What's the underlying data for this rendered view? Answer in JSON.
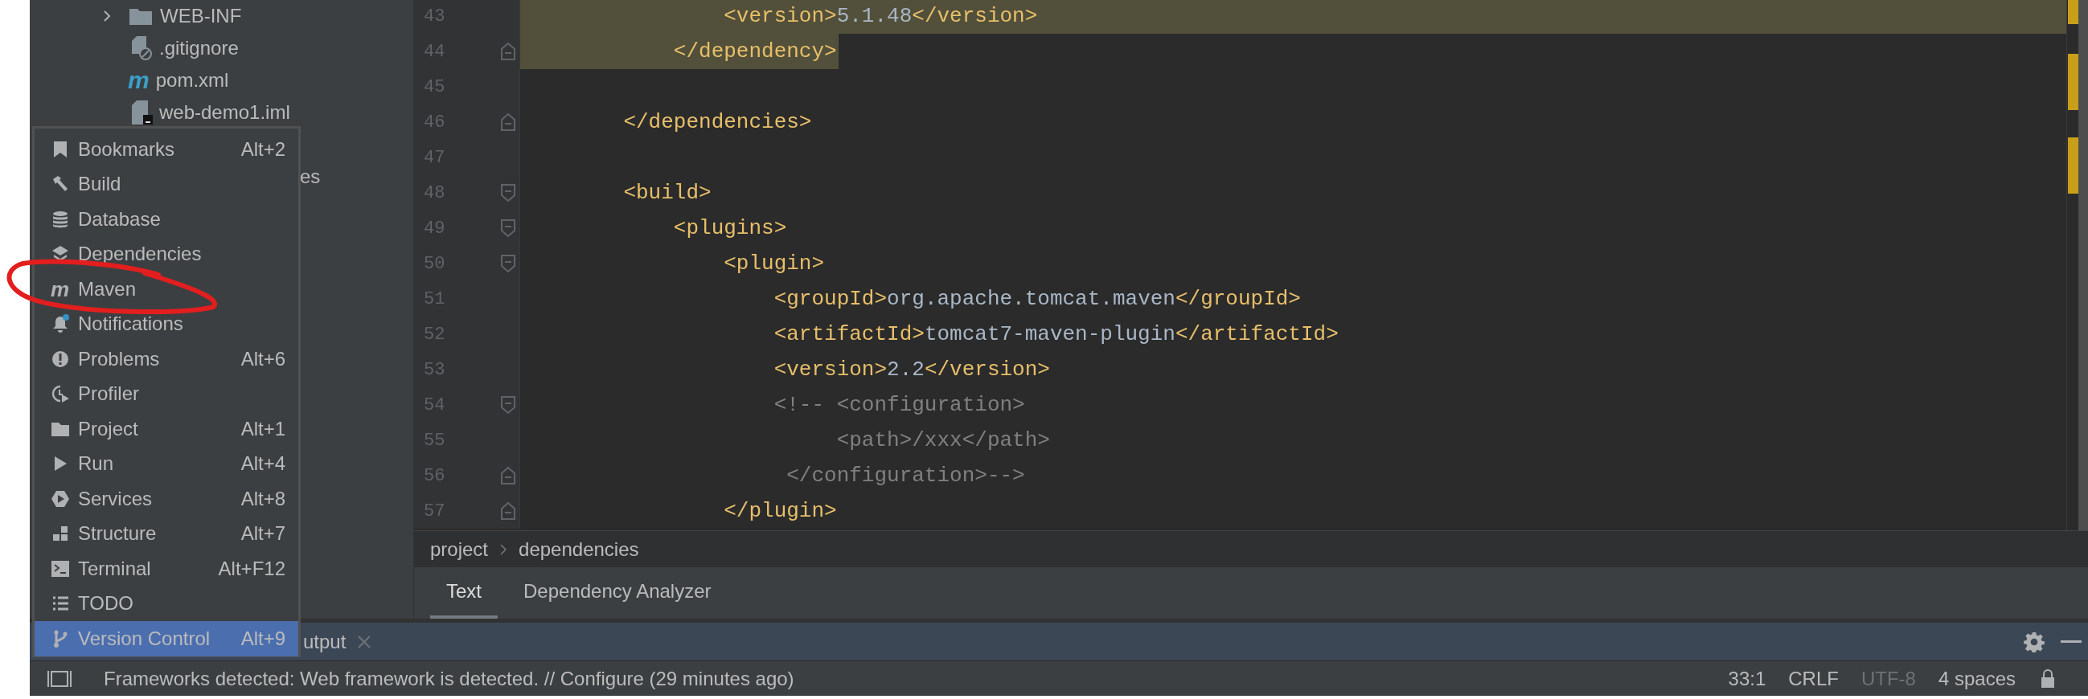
{
  "project_tree": [
    {
      "label": "WEB-INF",
      "kind": "folder",
      "expanded": false
    },
    {
      "label": ".gitignore",
      "kind": "ignore-file"
    },
    {
      "label": "pom.xml",
      "kind": "maven",
      "icon_glyph": "m"
    },
    {
      "label": "web-demo1.iml",
      "kind": "module-file"
    },
    {
      "label": "es",
      "kind": "partial"
    }
  ],
  "editor": {
    "lines": [
      {
        "number": "43",
        "kind": "plain",
        "selected": true,
        "selection_to_line_end": true,
        "segments": [
          {
            "kind": "tag",
            "text": "            <version>"
          },
          {
            "kind": "value",
            "text": "5.1.48"
          },
          {
            "kind": "tag",
            "text": "</version>"
          }
        ]
      },
      {
        "number": "44",
        "kind": "fold-end",
        "selected": true,
        "selection_to_line_end": false,
        "segments": [
          {
            "kind": "tag",
            "text": "        </dependency>"
          }
        ]
      },
      {
        "number": "45",
        "kind": "plain",
        "selected": false
      },
      {
        "number": "46",
        "kind": "fold-end",
        "selected": false,
        "segments": [
          {
            "kind": "tag",
            "text": "    </dependencies>"
          }
        ]
      },
      {
        "number": "47",
        "kind": "plain",
        "selected": false
      },
      {
        "number": "48",
        "kind": "fold-start",
        "selected": false,
        "segments": [
          {
            "kind": "tag",
            "text": "    <build>"
          }
        ]
      },
      {
        "number": "49",
        "kind": "fold-start",
        "selected": false,
        "segments": [
          {
            "kind": "tag",
            "text": "        <plugins>"
          }
        ]
      },
      {
        "number": "50",
        "kind": "fold-start",
        "selected": false,
        "segments": [
          {
            "kind": "tag",
            "text": "            <plugin>"
          }
        ]
      },
      {
        "number": "51",
        "kind": "plain",
        "selected": false,
        "segments": [
          {
            "kind": "tag",
            "text": "                <groupId>"
          },
          {
            "kind": "value",
            "text": "org.apache.tomcat.maven"
          },
          {
            "kind": "tag",
            "text": "</groupId>"
          }
        ]
      },
      {
        "number": "52",
        "kind": "plain",
        "selected": false,
        "segments": [
          {
            "kind": "tag",
            "text": "                <artifactId>"
          },
          {
            "kind": "value",
            "text": "tomcat7-maven-plugin"
          },
          {
            "kind": "tag",
            "text": "</artifactId>"
          }
        ]
      },
      {
        "number": "53",
        "kind": "plain",
        "selected": false,
        "segments": [
          {
            "kind": "tag",
            "text": "                <version>"
          },
          {
            "kind": "value",
            "text": "2.2"
          },
          {
            "kind": "tag",
            "text": "</version>"
          }
        ]
      },
      {
        "number": "54",
        "kind": "fold-start",
        "selected": false,
        "segments": [
          {
            "kind": "comment",
            "text": "                <!-- <configuration>"
          }
        ]
      },
      {
        "number": "55",
        "kind": "plain",
        "selected": false,
        "segments": [
          {
            "kind": "comment",
            "text": "                     <path>/xxx</path>"
          }
        ]
      },
      {
        "number": "56",
        "kind": "fold-end",
        "selected": false,
        "segments": [
          {
            "kind": "comment",
            "text": "                 </configuration>-->"
          }
        ]
      },
      {
        "number": "57",
        "kind": "fold-end",
        "selected": false,
        "segments": [
          {
            "kind": "tag",
            "text": "            </plugin>"
          }
        ]
      }
    ]
  },
  "breadcrumbs": [
    "project",
    "dependencies"
  ],
  "editor_tabs": [
    {
      "label": "Text",
      "selected": true
    },
    {
      "label": "Dependency Analyzer",
      "selected": false
    }
  ],
  "tool_window": {
    "tab_label": "utput"
  },
  "tool_windows_menu": [
    {
      "label": "Bookmarks",
      "shortcut": "Alt+2",
      "selected": false
    },
    {
      "label": "Build",
      "selected": false
    },
    {
      "label": "Database",
      "selected": false
    },
    {
      "label": "Dependencies",
      "selected": false
    },
    {
      "label": "Maven",
      "icon_glyph": "m",
      "selected": false
    },
    {
      "label": "Notifications",
      "selected": false
    },
    {
      "label": "Problems",
      "shortcut": "Alt+6",
      "selected": false
    },
    {
      "label": "Profiler",
      "selected": false
    },
    {
      "label": "Project",
      "shortcut": "Alt+1",
      "selected": false
    },
    {
      "label": "Run",
      "shortcut": "Alt+4",
      "selected": false
    },
    {
      "label": "Services",
      "shortcut": "Alt+8",
      "selected": false
    },
    {
      "label": "Structure",
      "shortcut": "Alt+7",
      "selected": false
    },
    {
      "label": "Terminal",
      "shortcut": "Alt+F12",
      "selected": false
    },
    {
      "label": "TODO",
      "selected": false
    },
    {
      "label": "Version Control",
      "shortcut": "Alt+9",
      "selected": true
    }
  ],
  "status_bar": {
    "message": "Frameworks detected: Web framework is detected. // Configure (29 minutes ago)",
    "position": "33:1",
    "line_separator": "CRLF",
    "encoding": "UTF-8",
    "indent": "4 spaces"
  }
}
